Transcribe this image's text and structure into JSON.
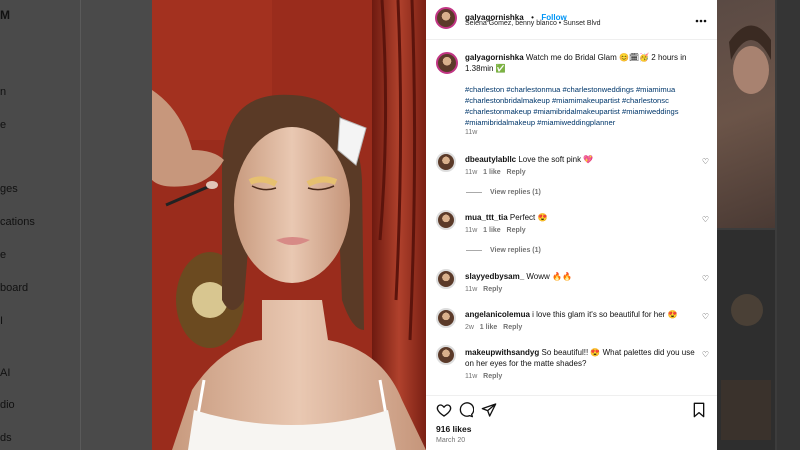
{
  "background": {
    "logo": "M",
    "nav_fragments": [
      "n",
      "e",
      "ges",
      "cations",
      "e",
      "board",
      "I",
      "AI",
      "dio",
      "ds"
    ]
  },
  "post": {
    "username": "galyagornishka",
    "separator": "•",
    "follow_label": "Follow",
    "audio_location": "Selena Gomez, benny blanco • Sunset Blvd",
    "more_icon": "ellipsis-icon",
    "caption_text": "Watch me do Bridal Glam 😊🗓🥳 2 hours in 1.38min ✅",
    "hashtags": "#charleston #charlestonmua #charlestonweddings #miamimua #charlestonbridalmakeup #miamimakeupartist #charlestonsc #charlestonmakeup #miamibridalmakeupartist #miamiweddings #miamibridalmakeup #miamiweddingplanner",
    "caption_time": "11w"
  },
  "comments": [
    {
      "username": "dbeautylabllc",
      "text": "Love the soft pink 💖",
      "time": "11w",
      "likes": "1 like",
      "reply": "Reply",
      "view_replies": "View replies (1)"
    },
    {
      "username": "mua_ttt_tia",
      "text": "Perfect 😍",
      "time": "11w",
      "likes": "1 like",
      "reply": "Reply",
      "view_replies": "View replies (1)"
    },
    {
      "username": "slayyedbysam_",
      "text": "Woww 🔥🔥",
      "time": "11w",
      "likes": "",
      "reply": "Reply"
    },
    {
      "username": "angelanicolemua",
      "text": "i love this glam it's so beautiful for her 😍",
      "time": "2w",
      "likes": "1 like",
      "reply": "Reply"
    },
    {
      "username": "makeupwithsandyg",
      "text": "So beautiful!! 😍 What palettes did you use on her eyes for the matte shades?",
      "time": "11w",
      "likes": "",
      "reply": "Reply"
    }
  ],
  "footer": {
    "likes": "916 likes",
    "date": "March 20"
  },
  "colors": {
    "follow": "#0095f6",
    "hashtag": "#00376b",
    "avatar_ring": "#c13584"
  }
}
